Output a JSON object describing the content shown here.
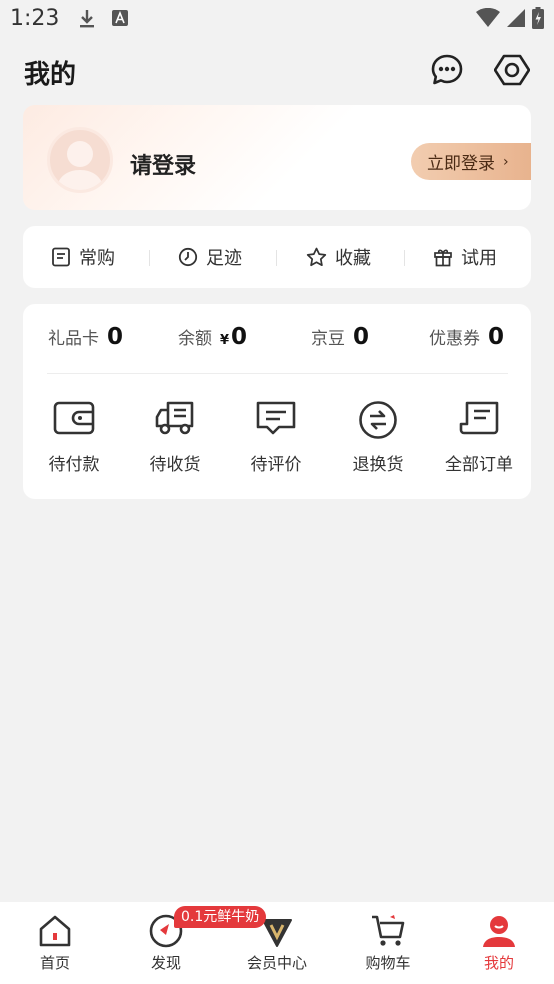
{
  "status_bar": {
    "time": "1:23"
  },
  "header": {
    "title": "我的"
  },
  "login": {
    "prompt": "请登录",
    "button_label": "立即登录",
    "chevron": "›"
  },
  "shortcuts": [
    {
      "label": "常购",
      "icon": "list-icon"
    },
    {
      "label": "足迹",
      "icon": "clock-icon"
    },
    {
      "label": "收藏",
      "icon": "star-icon"
    },
    {
      "label": "试用",
      "icon": "gift-icon"
    }
  ],
  "assets": [
    {
      "label": "礼品卡",
      "value": "0"
    },
    {
      "label": "余额",
      "prefix": "¥",
      "value": "0"
    },
    {
      "label": "京豆",
      "value": "0"
    },
    {
      "label": "优惠券",
      "value": "0"
    }
  ],
  "orders": [
    {
      "label": "待付款",
      "icon": "wallet-icon"
    },
    {
      "label": "待收货",
      "icon": "truck-icon"
    },
    {
      "label": "待评价",
      "icon": "comment-icon"
    },
    {
      "label": "退换货",
      "icon": "exchange-icon"
    },
    {
      "label": "全部订单",
      "icon": "orders-icon"
    }
  ],
  "bottom_nav": {
    "items": [
      {
        "label": "首页",
        "icon": "home-icon"
      },
      {
        "label": "发现",
        "icon": "discover-icon"
      },
      {
        "label": "会员中心",
        "icon": "vip-icon"
      },
      {
        "label": "购物车",
        "icon": "cart-icon"
      },
      {
        "label": "我的",
        "icon": "profile-icon",
        "active": true
      }
    ],
    "promo_badge": "0.1元鲜牛奶"
  },
  "colors": {
    "accent": "#e4393c",
    "login_button": "#e8b38e",
    "background": "#f2f2f2"
  }
}
